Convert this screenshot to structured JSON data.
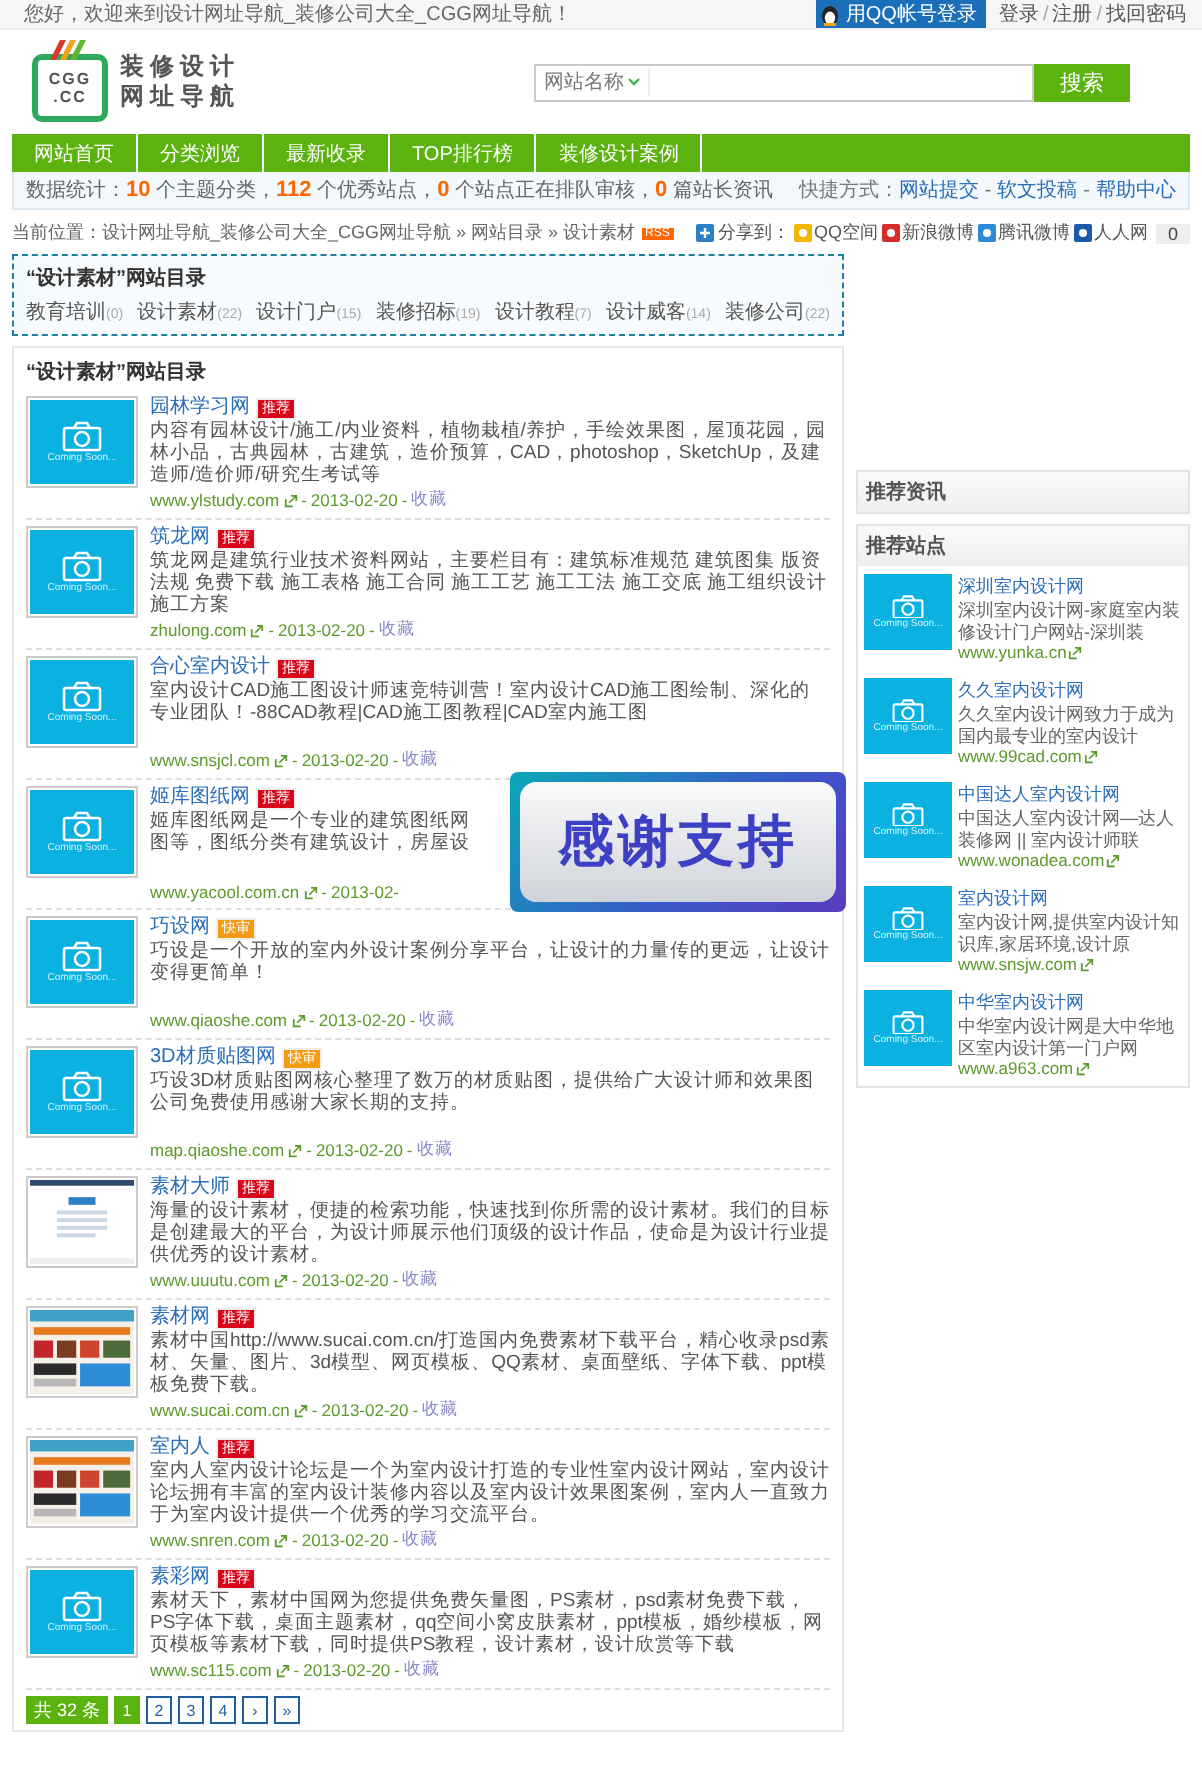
{
  "top_bar": {
    "greeting": "您好，欢迎来到设计网址导航_装修公司大全_CGG网址导航！",
    "qq_login": "用QQ帐号登录",
    "links": [
      "登录",
      "注册",
      "找回密码"
    ],
    "separator": "/"
  },
  "logo": {
    "mark_top": "CGG",
    "mark_bottom": ".CC",
    "title_lines": [
      "装修设计",
      "网址导航"
    ]
  },
  "search": {
    "select": "网站名称",
    "button": "搜索"
  },
  "nav": [
    "网站首页",
    "分类浏览",
    "最新收录",
    "TOP排行榜",
    "装修设计案例"
  ],
  "stats": {
    "text": "数据统计：**10** 个主题分类，**112** 个优秀站点，**0** 个站点正在排队审核，**0** 篇站长资讯",
    "quick_label": "快捷方式：",
    "quick_links": [
      "网站提交",
      "软文投稿",
      "帮助中心"
    ],
    "separator": "-"
  },
  "breadcrumb": {
    "text": "当前位置：设计网址导航_装修公司大全_CGG网址导航 » 网站目录 » 设计素材",
    "rss": "RSS",
    "share_label": "分享到：",
    "share_items": [
      {
        "kind": "qzone",
        "label": "QQ空间"
      },
      {
        "kind": "weibo",
        "label": "新浪微博"
      },
      {
        "kind": "tencent",
        "label": "腾讯微博"
      },
      {
        "kind": "renren",
        "label": "人人网"
      }
    ],
    "share_count": "0"
  },
  "category_box": {
    "title": "“设计素材”网站目录",
    "items": [
      {
        "name": "教育培训",
        "count": "(0)"
      },
      {
        "name": "设计素材",
        "count": "(22)"
      },
      {
        "name": "设计门户",
        "count": "(15)"
      },
      {
        "name": "装修招标",
        "count": "(19)"
      },
      {
        "name": "设计教程",
        "count": "(7)"
      },
      {
        "name": "设计威客",
        "count": "(14)"
      },
      {
        "name": "装修公司",
        "count": "(22)"
      }
    ]
  },
  "list": {
    "title": "“设计素材”网站目录",
    "separator": "-",
    "items": [
      {
        "name": "园林学习网",
        "badge": {
          "kind": "recommend",
          "text": "推荐"
        },
        "thumb": {
          "kind": "placeholder",
          "caption": "Coming Soon..."
        },
        "description": "内容有园林设计/施工/内业资料，植物栽植/养护，手绘效果图，屋顶花园，园林小品，古典园林，古建筑，造价预算，CAD，photoshop，SketchUp，及建造师/造价师/研究生考试等",
        "url": "www.ylstudy.com",
        "date": "2013-02-20",
        "action": "收藏"
      },
      {
        "name": "筑龙网",
        "badge": {
          "kind": "recommend",
          "text": "推荐"
        },
        "thumb": {
          "kind": "placeholder",
          "caption": "Coming Soon..."
        },
        "description": "筑龙网是建筑行业技术资料网站，主要栏目有：建筑标准规范 建筑图集 版资法规 免费下载 施工表格 施工合同 施工工艺 施工工法 施工交底 施工组织设计施工方案",
        "url": "zhulong.com",
        "date": "2013-02-20",
        "action": "收藏"
      },
      {
        "name": "合心室内设计",
        "badge": {
          "kind": "recommend",
          "text": "推荐"
        },
        "thumb": {
          "kind": "placeholder",
          "caption": "Coming Soon..."
        },
        "description": "室内设计CAD施工图设计师速竞特训营！室内设计CAD施工图绘制、深化的专业团队！-88CAD教程|CAD施工图教程|CAD室内施工图",
        "url": "www.snsjcl.com",
        "date": "2013-02-20",
        "action": "收藏"
      },
      {
        "name": "姬库图纸网",
        "badge": {
          "kind": "recommend",
          "text": "推荐"
        },
        "thumb": {
          "kind": "placeholder",
          "caption": "Coming Soon..."
        },
        "description_lines": [
          "姬库图纸网是一个专业的建筑图纸网",
          "图等，图纸分类有建筑设计，房屋设"
        ],
        "url": "www.yacool.com.cn",
        "date": "2013-02-",
        "covered": true
      },
      {
        "name": "巧设网",
        "badge": {
          "kind": "fast",
          "text": "快审"
        },
        "thumb": {
          "kind": "placeholder",
          "caption": "Coming Soon..."
        },
        "description": "巧设是一个开放的室内外设计案例分享平台，让设计的力量传的更远，让设计变得更简单！",
        "url": "www.qiaoshe.com",
        "date": "2013-02-20",
        "action": "收藏"
      },
      {
        "name": "3D材质贴图网",
        "badge": {
          "kind": "fast",
          "text": "快审"
        },
        "thumb": {
          "kind": "placeholder",
          "caption": "Coming Soon..."
        },
        "description": "巧设3D材质贴图网核心整理了数万的材质贴图，提供给广大设计师和效果图公司免费使用感谢大家长期的支持。",
        "url": "map.qiaoshe.com",
        "date": "2013-02-20",
        "action": "收藏"
      },
      {
        "name": "素材大师",
        "badge": {
          "kind": "recommend",
          "text": "推荐"
        },
        "thumb": {
          "kind": "page"
        },
        "description": "海量的设计素材，便捷的检索功能，快速找到你所需的设计素材。我们的目标是创建最大的平台，为设计师展示他们顶级的设计作品，使命是为设计行业提供优秀的设计素材。",
        "url": "www.uuutu.com",
        "date": "2013-02-20",
        "action": "收藏"
      },
      {
        "name": "素材网",
        "badge": {
          "kind": "recommend",
          "text": "推荐"
        },
        "thumb": {
          "kind": "gallery"
        },
        "description": "素材中国http://www.sucai.com.cn/打造国内免费素材下载平台，精心收录psd素材、矢量、图片、3d模型、网页模板、QQ素材、桌面壁纸、字体下载、ppt模板免费下载。",
        "url": "www.sucai.com.cn",
        "date": "2013-02-20",
        "action": "收藏"
      },
      {
        "name": "室内人",
        "badge": {
          "kind": "recommend",
          "text": "推荐"
        },
        "thumb": {
          "kind": "gallery"
        },
        "description": "室内人室内设计论坛是一个为室内设计打造的专业性室内设计网站，室内设计论坛拥有丰富的室内设计装修内容以及室内设计效果图案例，室内人一直致力于为室内设计提供一个优秀的学习交流平台。",
        "url": "www.snren.com",
        "date": "2013-02-20",
        "action": "收藏"
      },
      {
        "name": "素彩网",
        "badge": {
          "kind": "recommend",
          "text": "推荐"
        },
        "thumb": {
          "kind": "placeholder",
          "caption": "Coming Soon..."
        },
        "description": "素材天下，素材中国网为您提供免费矢量图，PS素材，psd素材免费下载，PS字体下载，桌面主题素材，qq空间小窝皮肤素材，ppt模板，婚纱模板，网页模板等素材下载，同时提供PS教程，设计素材，设计欣赏等下载",
        "url": "www.sc115.com",
        "date": "2013-02-20",
        "action": "收藏"
      }
    ]
  },
  "banner": {
    "text": "感谢支持"
  },
  "pagination": {
    "total": "共 32 条",
    "pages": [
      {
        "label": "1",
        "selected": true
      },
      {
        "label": "2",
        "selected": false
      },
      {
        "label": "3",
        "selected": false
      },
      {
        "label": "4",
        "selected": false
      }
    ],
    "next": "›",
    "last": "»"
  },
  "sidebar": {
    "sections": [
      {
        "title": "推荐资讯"
      },
      {
        "title": "推荐站点",
        "sites": [
          {
            "name": "深圳室内设计网",
            "description": "深圳室内设计网-家庭室内装修设计门户网站-深圳装",
            "url": "www.yunka.cn",
            "caption": "Coming Soon..."
          },
          {
            "name": "久久室内设计网",
            "description": "久久室内设计网致力于成为国内最专业的室内设计",
            "url": "www.99cad.com",
            "caption": "Coming Soon..."
          },
          {
            "name": "中国达人室内设计网",
            "description": "中国达人室内设计网—达人装修网 || 室内设计师联",
            "url": "www.wonadea.com",
            "caption": "Coming Soon..."
          },
          {
            "name": "室内设计网",
            "description": "室内设计网,提供室内设计知识库,家居环境,设计原",
            "url": "www.snsjw.com",
            "caption": "Coming Soon..."
          },
          {
            "name": "中华室内设计网",
            "description": "中华室内设计网是大中华地区室内设计第一门户网",
            "url": "www.a963.com",
            "caption": "Coming Soon..."
          }
        ]
      }
    ]
  }
}
